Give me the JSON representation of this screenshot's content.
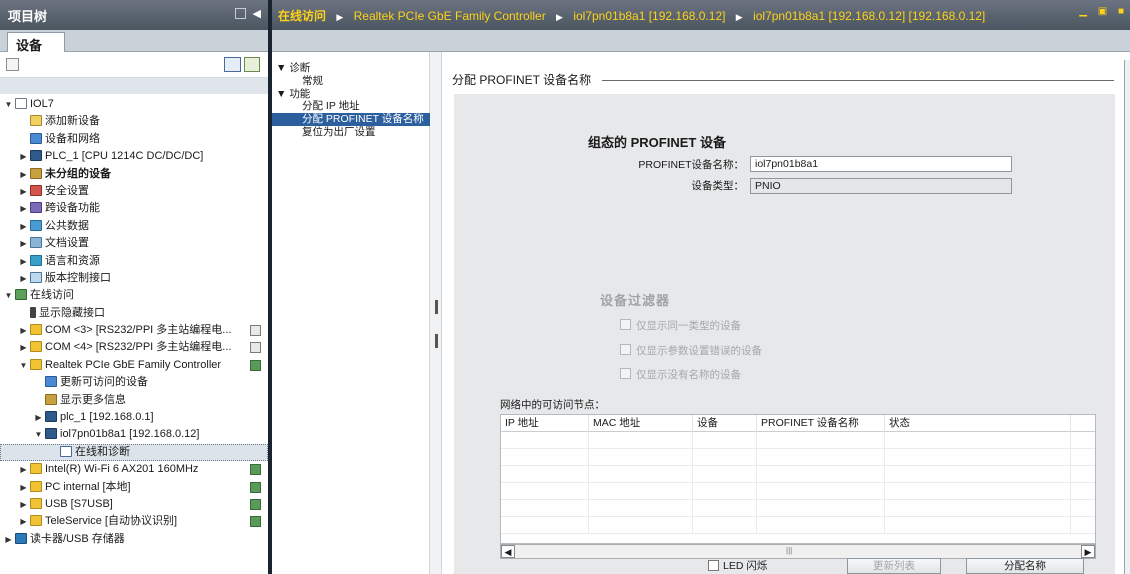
{
  "left_panel": {
    "title": "项目树",
    "tab": "设备",
    "tree": [
      {
        "label": "IOL7",
        "indent": 0,
        "exp": "▼",
        "icon": "project-icon",
        "cls": "i-proj"
      },
      {
        "label": "添加新设备",
        "indent": 1,
        "exp": "",
        "icon": "add-device-icon",
        "cls": "i-add"
      },
      {
        "label": "设备和网络",
        "indent": 1,
        "exp": "",
        "icon": "network-icon",
        "cls": "i-net"
      },
      {
        "label": "PLC_1 [CPU 1214C DC/DC/DC]",
        "indent": 1,
        "exp": "▶",
        "icon": "plc-icon",
        "cls": "i-plc"
      },
      {
        "label": "未分组的设备",
        "indent": 1,
        "exp": "▶",
        "icon": "ungrouped-devices-icon",
        "cls": "i-dev",
        "bold": true
      },
      {
        "label": "安全设置",
        "indent": 1,
        "exp": "▶",
        "icon": "security-icon",
        "cls": "i-sec"
      },
      {
        "label": "跨设备功能",
        "indent": 1,
        "exp": "▶",
        "icon": "cross-device-icon",
        "cls": "i-multi"
      },
      {
        "label": "公共数据",
        "indent": 1,
        "exp": "▶",
        "icon": "common-data-icon",
        "cls": "i-data"
      },
      {
        "label": "文档设置",
        "indent": 1,
        "exp": "▶",
        "icon": "document-icon",
        "cls": "i-doc"
      },
      {
        "label": "语言和资源",
        "indent": 1,
        "exp": "▶",
        "icon": "language-icon",
        "cls": "i-lang"
      },
      {
        "label": "版本控制接口",
        "indent": 1,
        "exp": "▶",
        "icon": "version-control-icon",
        "cls": "i-ver"
      },
      {
        "label": "在线访问",
        "indent": 0,
        "exp": "▼",
        "icon": "online-access-icon",
        "cls": "i-online"
      },
      {
        "label": "显示隐藏接口",
        "indent": 1,
        "exp": "",
        "icon": "pin-icon",
        "cls": "i-pin"
      },
      {
        "label": "COM <3> [RS232/PPI 多主站编程电...",
        "indent": 1,
        "exp": "▶",
        "icon": "interface-icon",
        "cls": "i-folder",
        "status": "unknown"
      },
      {
        "label": "COM <4> [RS232/PPI 多主站编程电...",
        "indent": 1,
        "exp": "▶",
        "icon": "interface-icon",
        "cls": "i-folder",
        "status": "unknown"
      },
      {
        "label": "Realtek PCIe GbE Family Controller",
        "indent": 1,
        "exp": "▼",
        "icon": "interface-icon",
        "cls": "i-folder",
        "status": "ok"
      },
      {
        "label": "更新可访问的设备",
        "indent": 2,
        "exp": "",
        "icon": "update-devices-icon",
        "cls": "i-net"
      },
      {
        "label": "显示更多信息",
        "indent": 2,
        "exp": "",
        "icon": "more-info-icon",
        "cls": "i-dev"
      },
      {
        "label": "plc_1 [192.168.0.1]",
        "indent": 2,
        "exp": "▶",
        "icon": "plc-icon",
        "cls": "i-plc"
      },
      {
        "label": "iol7pn01b8a1 [192.168.0.12]",
        "indent": 2,
        "exp": "▼",
        "icon": "device-icon",
        "cls": "i-plc"
      },
      {
        "label": "在线和诊断",
        "indent": 3,
        "exp": "",
        "icon": "diagnostics-icon",
        "cls": "i-diag",
        "selected": true
      },
      {
        "label": "Intel(R) Wi-Fi 6 AX201 160MHz",
        "indent": 1,
        "exp": "▶",
        "icon": "interface-icon",
        "cls": "i-folder",
        "status": "ok"
      },
      {
        "label": "PC internal [本地]",
        "indent": 1,
        "exp": "▶",
        "icon": "interface-icon",
        "cls": "i-folder",
        "status": "ok"
      },
      {
        "label": "USB [S7USB]",
        "indent": 1,
        "exp": "▶",
        "icon": "interface-icon",
        "cls": "i-folder",
        "status": "ok"
      },
      {
        "label": "TeleService [自动协议识别]",
        "indent": 1,
        "exp": "▶",
        "icon": "interface-icon",
        "cls": "i-folder",
        "status": "ok"
      },
      {
        "label": "读卡器/USB 存储器",
        "indent": 0,
        "exp": "▶",
        "icon": "card-reader-icon",
        "cls": "i-card"
      }
    ]
  },
  "header": {
    "online": "在线访问",
    "crumbs": [
      "Realtek PCIe GbE Family Controller",
      "iol7pn01b8a1 [192.168.0.12]",
      "iol7pn01b8a1 [192.168.0.12] [192.168.0.12]"
    ]
  },
  "nav": {
    "items": [
      {
        "label": "诊断",
        "child": false,
        "exp": "▼ "
      },
      {
        "label": "常规",
        "child": true,
        "exp": ""
      },
      {
        "label": "功能",
        "child": false,
        "exp": "▼ "
      },
      {
        "label": "分配 IP 地址",
        "child": true,
        "exp": ""
      },
      {
        "label": "分配 PROFINET 设备名称",
        "child": true,
        "exp": "",
        "selected": true
      },
      {
        "label": "复位为出厂设置",
        "child": true,
        "exp": ""
      }
    ]
  },
  "main": {
    "section_title": "分配 PROFINET 设备名称",
    "config_title": "组态的 PROFINET 设备",
    "name_label": "PROFINET设备名称：",
    "name_value": "iol7pn01b8a1",
    "type_label": "设备类型：",
    "type_value": "PNIO",
    "filter_title": "设备过滤器",
    "filters": [
      "仅显示同一类型的设备",
      "仅显示参数设置错误的设备",
      "仅显示没有名称的设备"
    ],
    "nodes_title": "网络中的可访问节点：",
    "columns": [
      "IP 地址",
      "MAC 地址",
      "设备",
      "PROFINET 设备名称",
      "状态"
    ],
    "led_label": "LED 闪烁",
    "refresh_button": "更新列表",
    "assign_button": "分配名称"
  },
  "colors": {
    "accent": "#2c5f9e",
    "breadcrumb": "#ffd21a",
    "header_bg": "#565f6b"
  }
}
